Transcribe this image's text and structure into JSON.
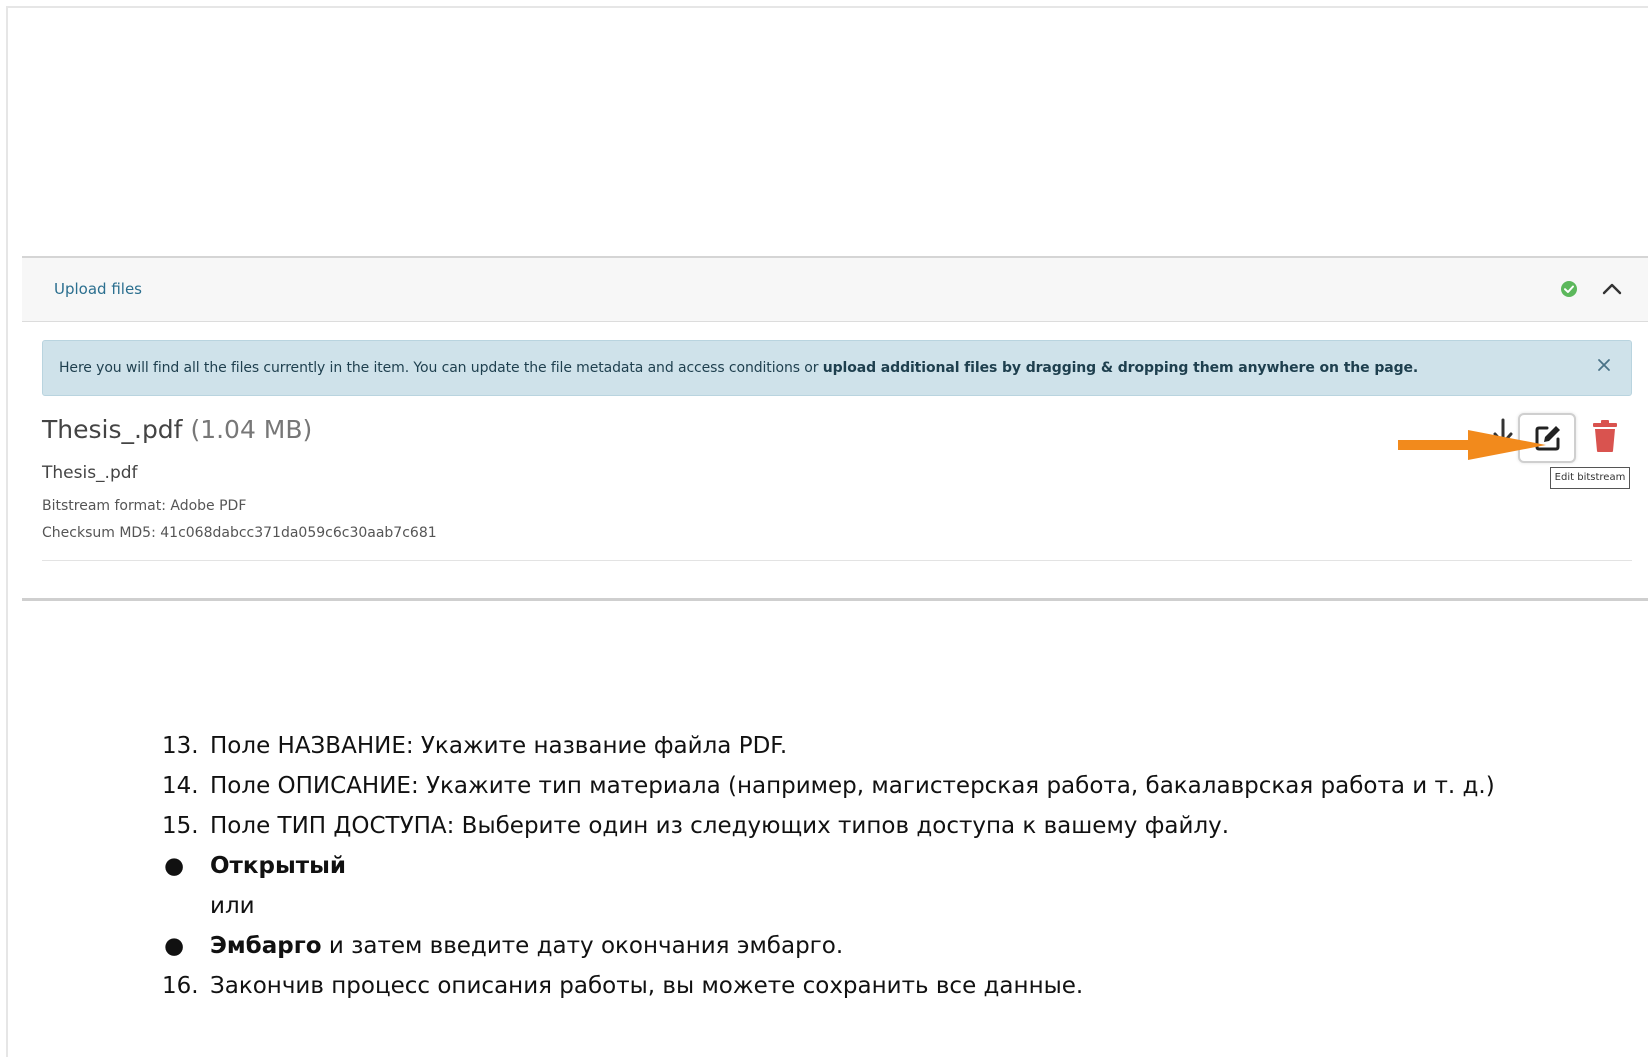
{
  "panel": {
    "title": "Upload files",
    "status_icon": "check-circle-icon",
    "collapse_icon": "chevron-up-icon",
    "alert": {
      "text_normal": "Here you will find all the files currently in the item. You can update the file metadata and access conditions or ",
      "text_bold": "upload additional files by dragging & dropping them anywhere on the page.",
      "close_icon": "close-icon"
    },
    "file": {
      "title": "Thesis_.pdf",
      "size": "(1.04 MB)",
      "name": "Thesis_.pdf",
      "format": "Bitstream format: Adobe PDF",
      "checksum": "Checksum MD5: 41c068dabcc371da059c6c30aab7c681"
    },
    "actions": {
      "download_icon": "download-icon",
      "edit_icon": "edit-icon",
      "delete_icon": "trash-icon",
      "tooltip": "Edit bitstream"
    },
    "colors": {
      "accent": "#2b6f8f",
      "alert_bg": "#cfe2ea",
      "success": "#5cb85c",
      "danger": "#d9534f",
      "arrow": "#f28a1c"
    }
  },
  "instructions": {
    "step13_num": "13.",
    "step13_text": "Поле НАЗВАНИЕ: Укажите название файла PDF.",
    "step14_num": "14.",
    "step14_text": "Поле ОПИСАНИЕ: Укажите тип материала (например, магистерская работа, бакалаврская работа и т. д.)",
    "step15_num": "15.",
    "step15_text": "Поле ТИП ДОСТУПА: Выберите один из следующих типов доступа к вашему файлу.",
    "bullet": "●",
    "option_open": "Открытый",
    "or_text": "или",
    "option_embargo": "Эмбарго",
    "embargo_note": " и затем введите дату окончания эмбарго.",
    "step16_num": "16.",
    "step16_text": "Закончив процесс описания работы, вы можете сохранить все данные."
  }
}
